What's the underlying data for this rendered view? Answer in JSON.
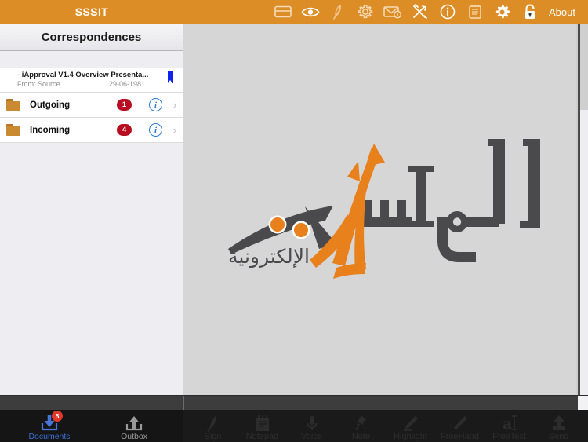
{
  "app": {
    "title": "SSSIT",
    "brand_orange": "#dd8d25"
  },
  "toolbar": {
    "icons": [
      {
        "name": "card-icon",
        "label": "Card"
      },
      {
        "name": "eye-icon",
        "label": "View"
      },
      {
        "name": "quill-icon",
        "label": "Sign"
      },
      {
        "name": "gear-outline-icon",
        "label": "Settings"
      },
      {
        "name": "envelope-info-icon",
        "label": "Mail Info"
      },
      {
        "name": "tools-icon",
        "label": "Tools"
      },
      {
        "name": "info-circle-icon",
        "label": "Info"
      },
      {
        "name": "notepad-icon",
        "label": "Notepad"
      },
      {
        "name": "gear-solid-icon",
        "label": "Preferences"
      },
      {
        "name": "lock-icon",
        "label": "Lock"
      }
    ],
    "about_label": "About"
  },
  "sidebar": {
    "nav_title": "Correspondences",
    "document": {
      "title": "- iApproval V1.4 Overview Presenta...",
      "from": "From: Source",
      "date": "29-06-1981",
      "flag_color": "#1122ee"
    },
    "folders": [
      {
        "name": "Outgoing",
        "count": "1",
        "icon": "folder-icon",
        "info": "i",
        "chevron": "›"
      },
      {
        "name": "Incoming",
        "count": "4",
        "icon": "folder-icon",
        "info": "i",
        "chevron": "›"
      }
    ],
    "badge_color": "#b80d20"
  },
  "main": {
    "logo": {
      "name": "almurasalat-logo",
      "arabic_title": "المراسلات",
      "arabic_subtitle": "الإلكترونية",
      "accent_color": "#e8801c",
      "dark_color": "#4a4a4d",
      "background": "#d6d6d6"
    }
  },
  "bottom_tabs_left": [
    {
      "label": "Documents",
      "icon": "download-inbox-icon",
      "badge": "5",
      "active": true
    },
    {
      "label": "Outbox",
      "icon": "upload-outbox-icon",
      "badge": "",
      "active": false
    }
  ],
  "bottom_tabs_right": [
    {
      "label": "Sign",
      "icon": "quill-pen-icon"
    },
    {
      "label": "Notepad",
      "icon": "notepad-icon"
    },
    {
      "label": "Voice",
      "icon": "microphone-icon"
    },
    {
      "label": "Note",
      "icon": "pushpin-note-icon"
    },
    {
      "label": "Highlight",
      "icon": "highlighter-icon"
    },
    {
      "label": "FreeHand",
      "icon": "pencil-icon"
    },
    {
      "label": "FreeText",
      "icon": "text-cursor-icon"
    },
    {
      "label": "Send",
      "icon": "send-upload-icon"
    }
  ]
}
